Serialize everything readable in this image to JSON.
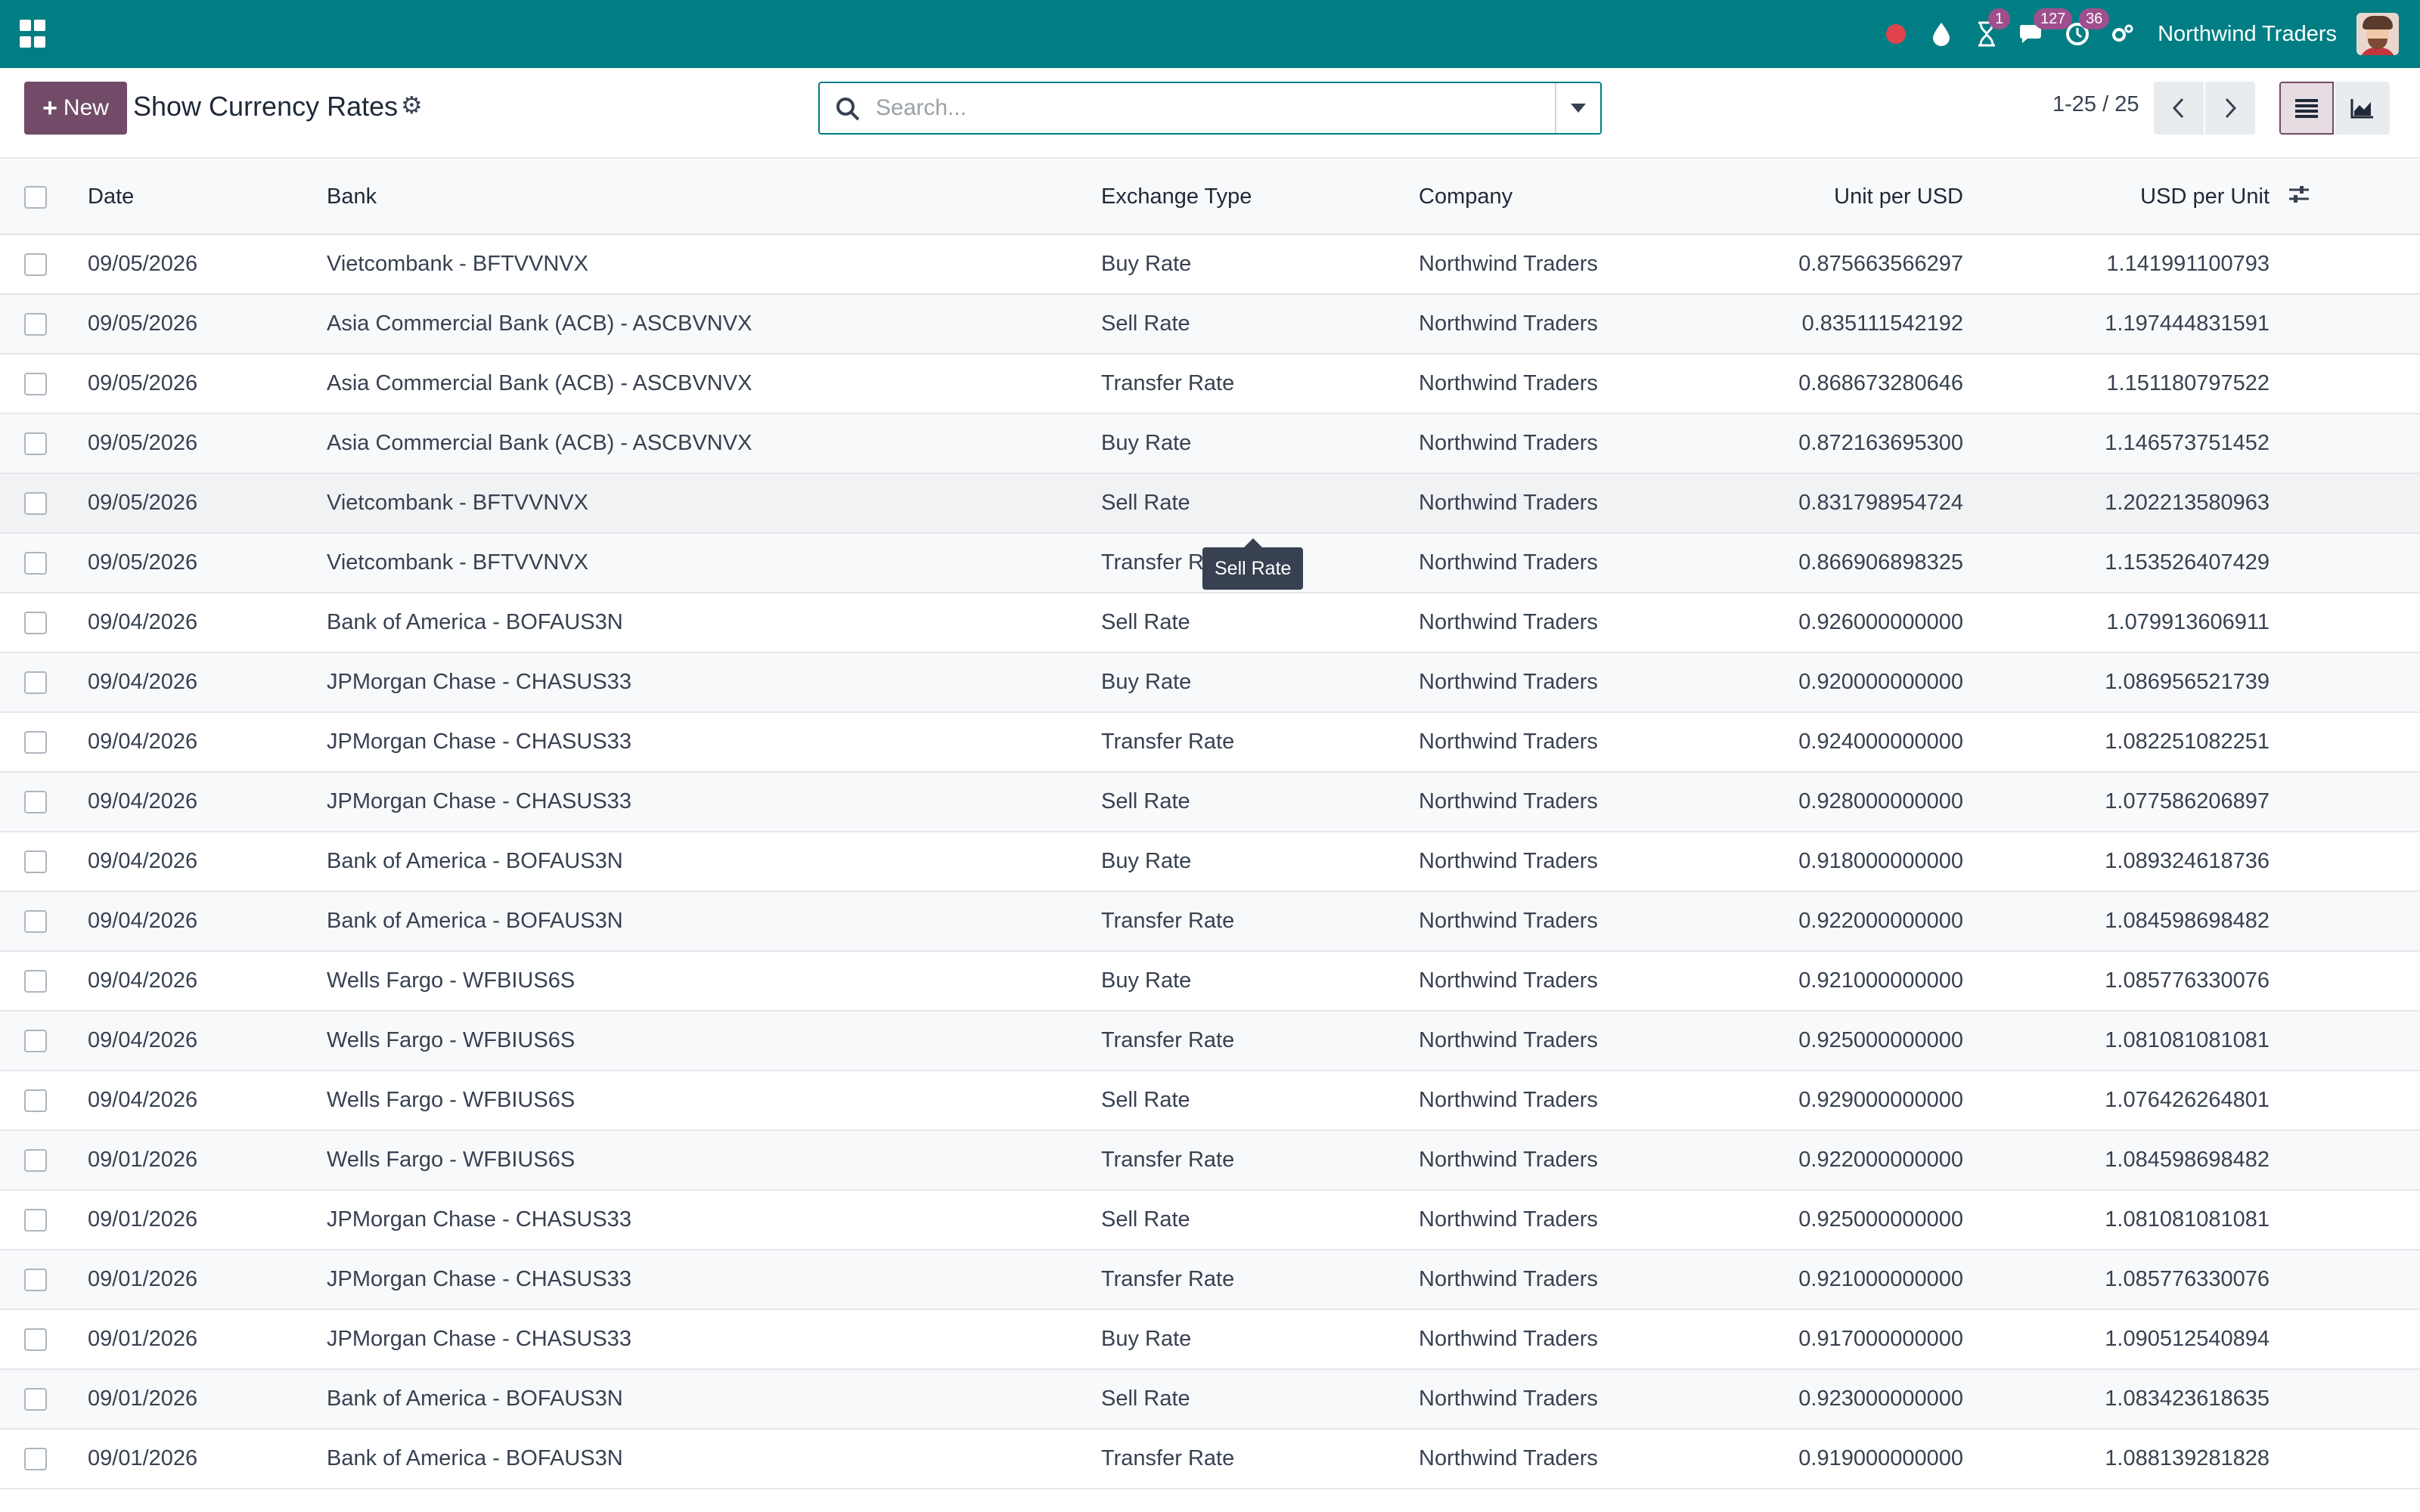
{
  "navbar": {
    "company": "Northwind Traders",
    "badges": {
      "activity": "1",
      "messages": "127",
      "timer": "36"
    },
    "colors": {
      "brand": "#017e84",
      "badge": "#9f4f8d",
      "recording": "#e0434b"
    }
  },
  "control": {
    "new_label": "New",
    "title": "Show Currency Rates",
    "search_placeholder": "Search...",
    "pager": "1-25 / 25"
  },
  "table": {
    "headers": {
      "date": "Date",
      "bank": "Bank",
      "type": "Exchange Type",
      "company": "Company",
      "unit": "Unit per USD",
      "usd": "USD per Unit"
    },
    "rows": [
      {
        "date": "09/05/2026",
        "bank": "Vietcombank - BFTVVNVX",
        "type": "Buy Rate",
        "company": "Northwind Traders",
        "unit": "0.875663566297",
        "usd": "1.141991100793"
      },
      {
        "date": "09/05/2026",
        "bank": "Asia Commercial Bank (ACB) - ASCBVNVX",
        "type": "Sell Rate",
        "company": "Northwind Traders",
        "unit": "0.835111542192",
        "usd": "1.197444831591"
      },
      {
        "date": "09/05/2026",
        "bank": "Asia Commercial Bank (ACB) - ASCBVNVX",
        "type": "Transfer Rate",
        "company": "Northwind Traders",
        "unit": "0.868673280646",
        "usd": "1.151180797522"
      },
      {
        "date": "09/05/2026",
        "bank": "Asia Commercial Bank (ACB) - ASCBVNVX",
        "type": "Buy Rate",
        "company": "Northwind Traders",
        "unit": "0.872163695300",
        "usd": "1.146573751452"
      },
      {
        "date": "09/05/2026",
        "bank": "Vietcombank - BFTVVNVX",
        "type": "Sell Rate",
        "company": "Northwind Traders",
        "unit": "0.831798954724",
        "usd": "1.202213580963"
      },
      {
        "date": "09/05/2026",
        "bank": "Vietcombank - BFTVVNVX",
        "type": "Transfer Rate",
        "company": "Northwind Traders",
        "unit": "0.866906898325",
        "usd": "1.153526407429"
      },
      {
        "date": "09/04/2026",
        "bank": "Bank of America - BOFAUS3N",
        "type": "Sell Rate",
        "company": "Northwind Traders",
        "unit": "0.926000000000",
        "usd": "1.079913606911"
      },
      {
        "date": "09/04/2026",
        "bank": "JPMorgan Chase - CHASUS33",
        "type": "Buy Rate",
        "company": "Northwind Traders",
        "unit": "0.920000000000",
        "usd": "1.086956521739"
      },
      {
        "date": "09/04/2026",
        "bank": "JPMorgan Chase - CHASUS33",
        "type": "Transfer Rate",
        "company": "Northwind Traders",
        "unit": "0.924000000000",
        "usd": "1.082251082251"
      },
      {
        "date": "09/04/2026",
        "bank": "JPMorgan Chase - CHASUS33",
        "type": "Sell Rate",
        "company": "Northwind Traders",
        "unit": "0.928000000000",
        "usd": "1.077586206897"
      },
      {
        "date": "09/04/2026",
        "bank": "Bank of America - BOFAUS3N",
        "type": "Buy Rate",
        "company": "Northwind Traders",
        "unit": "0.918000000000",
        "usd": "1.089324618736"
      },
      {
        "date": "09/04/2026",
        "bank": "Bank of America - BOFAUS3N",
        "type": "Transfer Rate",
        "company": "Northwind Traders",
        "unit": "0.922000000000",
        "usd": "1.084598698482"
      },
      {
        "date": "09/04/2026",
        "bank": "Wells Fargo - WFBIUS6S",
        "type": "Buy Rate",
        "company": "Northwind Traders",
        "unit": "0.921000000000",
        "usd": "1.085776330076"
      },
      {
        "date": "09/04/2026",
        "bank": "Wells Fargo - WFBIUS6S",
        "type": "Transfer Rate",
        "company": "Northwind Traders",
        "unit": "0.925000000000",
        "usd": "1.081081081081"
      },
      {
        "date": "09/04/2026",
        "bank": "Wells Fargo - WFBIUS6S",
        "type": "Sell Rate",
        "company": "Northwind Traders",
        "unit": "0.929000000000",
        "usd": "1.076426264801"
      },
      {
        "date": "09/01/2026",
        "bank": "Wells Fargo - WFBIUS6S",
        "type": "Transfer Rate",
        "company": "Northwind Traders",
        "unit": "0.922000000000",
        "usd": "1.084598698482"
      },
      {
        "date": "09/01/2026",
        "bank": "JPMorgan Chase - CHASUS33",
        "type": "Sell Rate",
        "company": "Northwind Traders",
        "unit": "0.925000000000",
        "usd": "1.081081081081"
      },
      {
        "date": "09/01/2026",
        "bank": "JPMorgan Chase - CHASUS33",
        "type": "Transfer Rate",
        "company": "Northwind Traders",
        "unit": "0.921000000000",
        "usd": "1.085776330076"
      },
      {
        "date": "09/01/2026",
        "bank": "JPMorgan Chase - CHASUS33",
        "type": "Buy Rate",
        "company": "Northwind Traders",
        "unit": "0.917000000000",
        "usd": "1.090512540894"
      },
      {
        "date": "09/01/2026",
        "bank": "Bank of America - BOFAUS3N",
        "type": "Sell Rate",
        "company": "Northwind Traders",
        "unit": "0.923000000000",
        "usd": "1.083423618635"
      },
      {
        "date": "09/01/2026",
        "bank": "Bank of America - BOFAUS3N",
        "type": "Transfer Rate",
        "company": "Northwind Traders",
        "unit": "0.919000000000",
        "usd": "1.088139281828"
      }
    ]
  },
  "tooltip": {
    "text": "Sell Rate"
  }
}
